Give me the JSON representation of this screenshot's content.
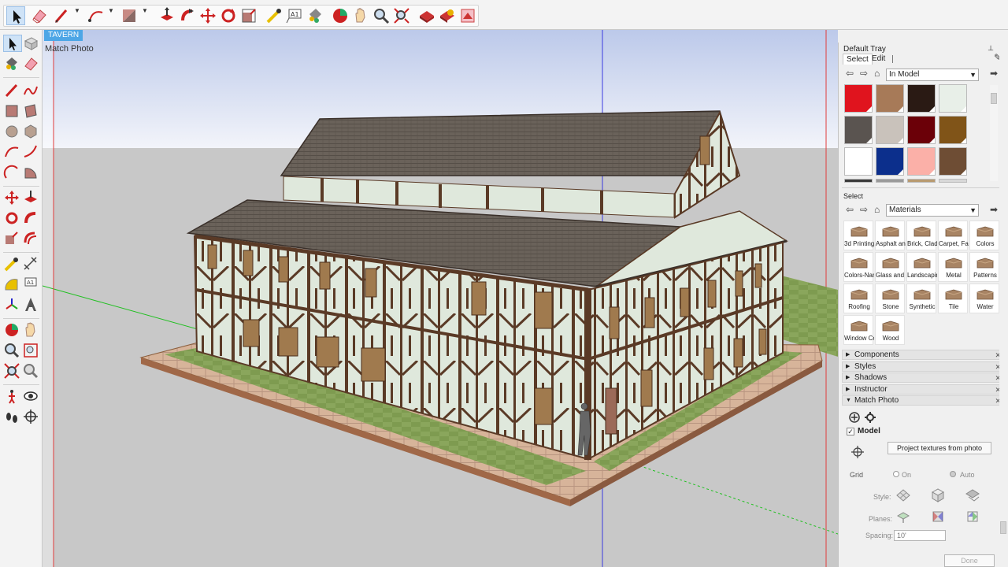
{
  "viewport": {
    "scene_tab": "TAVERN",
    "label": "Match Photo"
  },
  "toolbar_icons": [
    "select-tool-icon",
    "eraser-tool-icon",
    "line-tool-icon",
    "arc-tool-icon",
    "rectangle-tool-icon",
    "push-pull-tool-icon",
    "follow-me-tool-icon",
    "move-tool-icon",
    "rotate-tool-icon",
    "scale-tool-icon",
    "tape-measure-icon",
    "text-tool-icon",
    "paint-bucket-icon",
    "orbit-icon",
    "pan-icon",
    "zoom-icon",
    "zoom-extents-icon",
    "warehouse-icon",
    "extension-warehouse-icon",
    "layout-icon"
  ],
  "tray": {
    "title": "Default Tray",
    "materials": {
      "tabs": [
        "Select",
        "Edit"
      ],
      "dropdown_in_model": "In Model",
      "swatch_colors": [
        "#e0141e",
        "#a77a58",
        "#2a1a14",
        "#e8efe8",
        "#5a5450",
        "#c9c2bb",
        "#6b0008",
        "#805418",
        "#ffffff",
        "#0c2f8c",
        "#fbb0a8",
        "#6e4d34"
      ],
      "section_label": "Select",
      "dropdown_library": "Materials",
      "library_items": [
        "3d Printing",
        "Asphalt and Concrete",
        "Brick, Cladding and Siding",
        "Carpet, Fabric, Leather",
        "Colors",
        "Colors-Named",
        "Glass and Mirrors",
        "Landscaping",
        "Metal",
        "Patterns",
        "Roofing",
        "Stone",
        "Synthetic",
        "Tile",
        "Water",
        "Window Coverings",
        "Wood"
      ]
    },
    "panels": [
      "Components",
      "Styles",
      "Shadows",
      "Instructor",
      "Match Photo"
    ],
    "match_photo": {
      "model_label": "Model",
      "project_button": "Project textures from photo",
      "grid_label": "Grid",
      "radio_on": "On",
      "radio_auto": "Auto",
      "style_label": "Style:",
      "planes_label": "Planes:",
      "spacing_label": "Spacing:",
      "spacing_value": "10'",
      "done_button": "Done"
    }
  }
}
